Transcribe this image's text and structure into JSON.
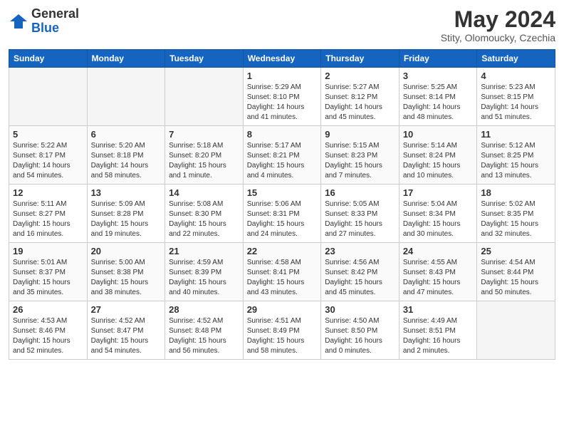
{
  "header": {
    "logo_line1": "General",
    "logo_line2": "Blue",
    "month": "May 2024",
    "location": "Stity, Olomoucky, Czechia"
  },
  "weekdays": [
    "Sunday",
    "Monday",
    "Tuesday",
    "Wednesday",
    "Thursday",
    "Friday",
    "Saturday"
  ],
  "weeks": [
    [
      {
        "day": "",
        "info": ""
      },
      {
        "day": "",
        "info": ""
      },
      {
        "day": "",
        "info": ""
      },
      {
        "day": "1",
        "info": "Sunrise: 5:29 AM\nSunset: 8:10 PM\nDaylight: 14 hours\nand 41 minutes."
      },
      {
        "day": "2",
        "info": "Sunrise: 5:27 AM\nSunset: 8:12 PM\nDaylight: 14 hours\nand 45 minutes."
      },
      {
        "day": "3",
        "info": "Sunrise: 5:25 AM\nSunset: 8:14 PM\nDaylight: 14 hours\nand 48 minutes."
      },
      {
        "day": "4",
        "info": "Sunrise: 5:23 AM\nSunset: 8:15 PM\nDaylight: 14 hours\nand 51 minutes."
      }
    ],
    [
      {
        "day": "5",
        "info": "Sunrise: 5:22 AM\nSunset: 8:17 PM\nDaylight: 14 hours\nand 54 minutes."
      },
      {
        "day": "6",
        "info": "Sunrise: 5:20 AM\nSunset: 8:18 PM\nDaylight: 14 hours\nand 58 minutes."
      },
      {
        "day": "7",
        "info": "Sunrise: 5:18 AM\nSunset: 8:20 PM\nDaylight: 15 hours\nand 1 minute."
      },
      {
        "day": "8",
        "info": "Sunrise: 5:17 AM\nSunset: 8:21 PM\nDaylight: 15 hours\nand 4 minutes."
      },
      {
        "day": "9",
        "info": "Sunrise: 5:15 AM\nSunset: 8:23 PM\nDaylight: 15 hours\nand 7 minutes."
      },
      {
        "day": "10",
        "info": "Sunrise: 5:14 AM\nSunset: 8:24 PM\nDaylight: 15 hours\nand 10 minutes."
      },
      {
        "day": "11",
        "info": "Sunrise: 5:12 AM\nSunset: 8:25 PM\nDaylight: 15 hours\nand 13 minutes."
      }
    ],
    [
      {
        "day": "12",
        "info": "Sunrise: 5:11 AM\nSunset: 8:27 PM\nDaylight: 15 hours\nand 16 minutes."
      },
      {
        "day": "13",
        "info": "Sunrise: 5:09 AM\nSunset: 8:28 PM\nDaylight: 15 hours\nand 19 minutes."
      },
      {
        "day": "14",
        "info": "Sunrise: 5:08 AM\nSunset: 8:30 PM\nDaylight: 15 hours\nand 22 minutes."
      },
      {
        "day": "15",
        "info": "Sunrise: 5:06 AM\nSunset: 8:31 PM\nDaylight: 15 hours\nand 24 minutes."
      },
      {
        "day": "16",
        "info": "Sunrise: 5:05 AM\nSunset: 8:33 PM\nDaylight: 15 hours\nand 27 minutes."
      },
      {
        "day": "17",
        "info": "Sunrise: 5:04 AM\nSunset: 8:34 PM\nDaylight: 15 hours\nand 30 minutes."
      },
      {
        "day": "18",
        "info": "Sunrise: 5:02 AM\nSunset: 8:35 PM\nDaylight: 15 hours\nand 32 minutes."
      }
    ],
    [
      {
        "day": "19",
        "info": "Sunrise: 5:01 AM\nSunset: 8:37 PM\nDaylight: 15 hours\nand 35 minutes."
      },
      {
        "day": "20",
        "info": "Sunrise: 5:00 AM\nSunset: 8:38 PM\nDaylight: 15 hours\nand 38 minutes."
      },
      {
        "day": "21",
        "info": "Sunrise: 4:59 AM\nSunset: 8:39 PM\nDaylight: 15 hours\nand 40 minutes."
      },
      {
        "day": "22",
        "info": "Sunrise: 4:58 AM\nSunset: 8:41 PM\nDaylight: 15 hours\nand 43 minutes."
      },
      {
        "day": "23",
        "info": "Sunrise: 4:56 AM\nSunset: 8:42 PM\nDaylight: 15 hours\nand 45 minutes."
      },
      {
        "day": "24",
        "info": "Sunrise: 4:55 AM\nSunset: 8:43 PM\nDaylight: 15 hours\nand 47 minutes."
      },
      {
        "day": "25",
        "info": "Sunrise: 4:54 AM\nSunset: 8:44 PM\nDaylight: 15 hours\nand 50 minutes."
      }
    ],
    [
      {
        "day": "26",
        "info": "Sunrise: 4:53 AM\nSunset: 8:46 PM\nDaylight: 15 hours\nand 52 minutes."
      },
      {
        "day": "27",
        "info": "Sunrise: 4:52 AM\nSunset: 8:47 PM\nDaylight: 15 hours\nand 54 minutes."
      },
      {
        "day": "28",
        "info": "Sunrise: 4:52 AM\nSunset: 8:48 PM\nDaylight: 15 hours\nand 56 minutes."
      },
      {
        "day": "29",
        "info": "Sunrise: 4:51 AM\nSunset: 8:49 PM\nDaylight: 15 hours\nand 58 minutes."
      },
      {
        "day": "30",
        "info": "Sunrise: 4:50 AM\nSunset: 8:50 PM\nDaylight: 16 hours\nand 0 minutes."
      },
      {
        "day": "31",
        "info": "Sunrise: 4:49 AM\nSunset: 8:51 PM\nDaylight: 16 hours\nand 2 minutes."
      },
      {
        "day": "",
        "info": ""
      }
    ]
  ]
}
